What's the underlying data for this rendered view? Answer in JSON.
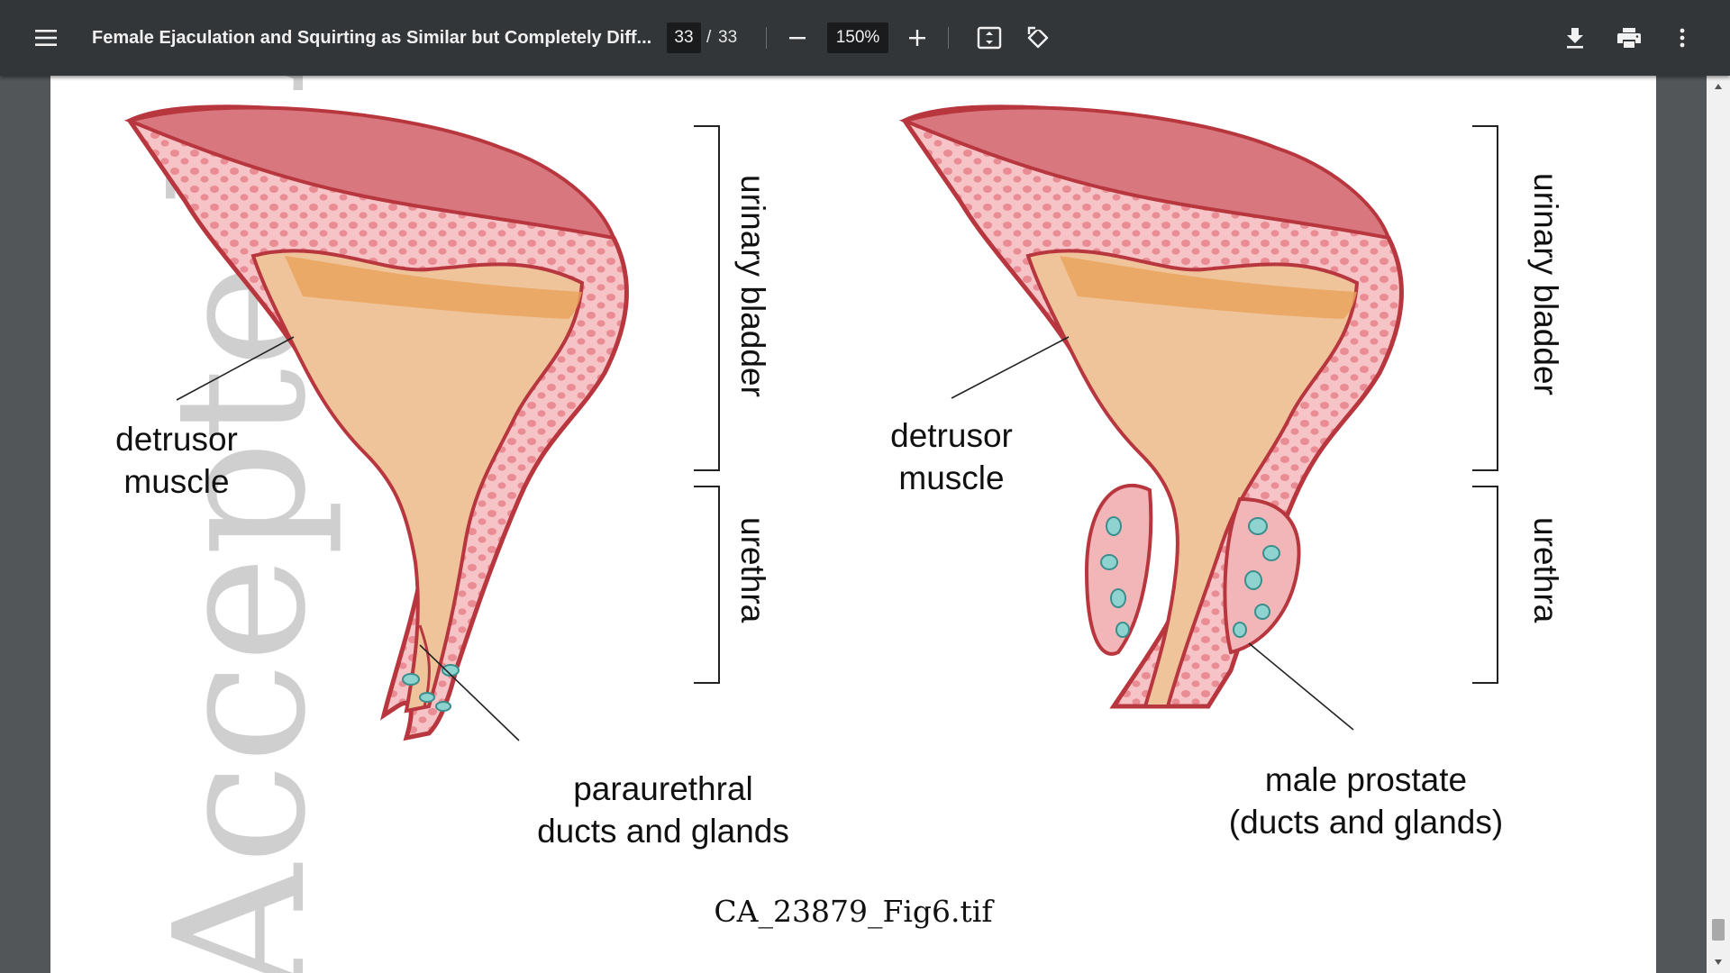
{
  "toolbar": {
    "menu_icon": "hamburger-menu-icon",
    "title": "Female Ejaculation and Squirting as Similar but Completely Diff...",
    "current_page": "33",
    "page_separator": "/",
    "total_pages": "33",
    "zoom": "150%",
    "icons": [
      "minus-icon",
      "plus-icon",
      "fit-page-icon",
      "rotate-icon",
      "download-icon",
      "print-icon",
      "more-vert-icon"
    ]
  },
  "figure": {
    "watermark": "Accepted Article",
    "left": {
      "bladder_label": "urinary bladder",
      "urethra_label": "urethra",
      "muscle_label_line1": "detrusor",
      "muscle_label_line2": "muscle",
      "glands_label_line1": "paraurethral",
      "glands_label_line2": "ducts and glands"
    },
    "right": {
      "bladder_label": "urinary bladder",
      "urethra_label": "urethra",
      "muscle_label_line1": "detrusor",
      "muscle_label_line2": "muscle",
      "glands_label_line1": "male prostate",
      "glands_label_line2": "(ducts and glands)"
    },
    "caption": "CA_23879_Fig6.tif",
    "colors": {
      "wall": "#f2b6b9",
      "wall_outline": "#b8373f",
      "lumen_top": "#d9777f",
      "urine": "#f0c49b",
      "urine_band": "#e9a35a",
      "gland": "#8fd3d0"
    }
  }
}
